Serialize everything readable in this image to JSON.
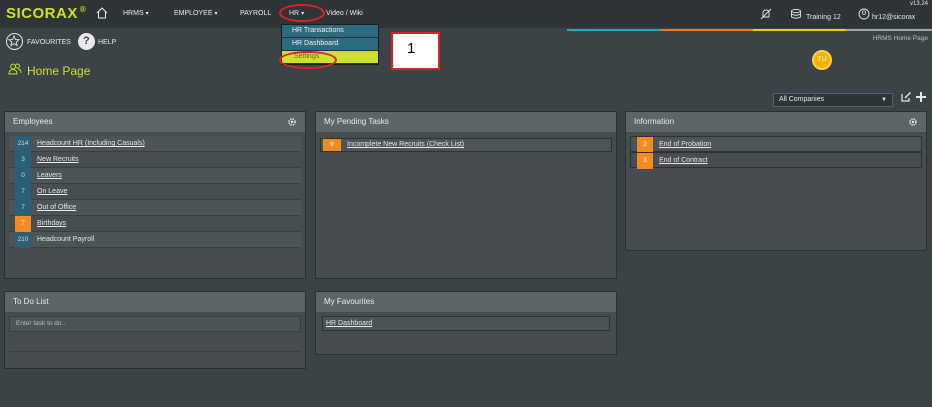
{
  "app": {
    "logo": "SICORAX",
    "registered": "®",
    "version": "v13.24"
  },
  "nav": {
    "items": [
      {
        "label": "HRMS",
        "dropdown": true
      },
      {
        "label": "EMPLOYEE",
        "dropdown": true
      },
      {
        "label": "PAYROLL",
        "dropdown": false
      },
      {
        "label": "HR",
        "dropdown": true
      },
      {
        "label": "Video / Wiki",
        "dropdown": false
      }
    ],
    "caret": "▾"
  },
  "hr_menu": {
    "items": [
      "HR Transactions",
      "HR Dashboard",
      "Settings"
    ],
    "active": "Settings"
  },
  "callout": {
    "label": "1"
  },
  "topright": {
    "database": "Training 12",
    "user": "hr12@sicorax"
  },
  "breadcrumb": {
    "text": "HRMS Home Page"
  },
  "toolbar": {
    "favourites_label": "FAVOURITES",
    "help_label": "HELP"
  },
  "page": {
    "title": "Home Page"
  },
  "user_badge": {
    "initials": "TU"
  },
  "company_filter": {
    "selected": "All Companies"
  },
  "panels": {
    "employees": {
      "title": "Employees",
      "rows": [
        {
          "count": "214",
          "label": "Headcount HR (Including Casuals)",
          "link": true,
          "highlight": false
        },
        {
          "count": "3",
          "label": "New Recruits",
          "link": true,
          "highlight": false
        },
        {
          "count": "0",
          "label": "Leavers",
          "link": true,
          "highlight": false
        },
        {
          "count": "7",
          "label": "On Leave",
          "link": true,
          "highlight": false
        },
        {
          "count": "7",
          "label": "Out of Office",
          "link": true,
          "highlight": false
        },
        {
          "count": "7",
          "label": "Birthdays",
          "link": true,
          "highlight": true
        },
        {
          "count": "210",
          "label": "Headcount Payroll",
          "link": false,
          "highlight": false
        }
      ]
    },
    "pending_tasks": {
      "title": "My Pending Tasks",
      "rows": [
        {
          "count": "9",
          "label": "Incomplete New Recruits (Check List)"
        }
      ]
    },
    "information": {
      "title": "Information",
      "rows": [
        {
          "count": "2",
          "label": "End of Probation"
        },
        {
          "count": "3",
          "label": "End of Contract"
        }
      ]
    },
    "todo": {
      "title": "To Do List",
      "placeholder": "Enter task to do.."
    },
    "favourites": {
      "title": "My Favourites",
      "items": [
        "HR Dashboard"
      ]
    }
  },
  "colors": {
    "accent": "#cde02a",
    "nav_bg": "#2f3436",
    "panel_header": "#5e6569",
    "count_blue": "#2a6076",
    "count_orange": "#f28c1e",
    "annotation_red": "#d9222a",
    "strips": [
      "#27a7bd",
      "#ef7d22",
      "#e9cf18",
      "#9aa5ab"
    ]
  }
}
